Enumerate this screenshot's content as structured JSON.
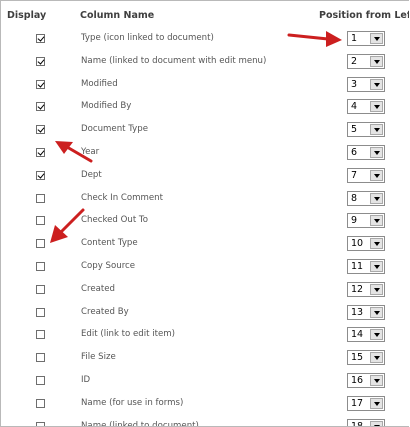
{
  "header": {
    "display": "Display",
    "column_name": "Column Name",
    "position": "Position from Lef"
  },
  "rows": [
    {
      "label": "Type (icon linked to document)",
      "checked": true,
      "position": "1"
    },
    {
      "label": "Name (linked to document with edit menu)",
      "checked": true,
      "position": "2"
    },
    {
      "label": "Modified",
      "checked": true,
      "position": "3"
    },
    {
      "label": "Modified By",
      "checked": true,
      "position": "4"
    },
    {
      "label": "Document Type",
      "checked": true,
      "position": "5"
    },
    {
      "label": "Year",
      "checked": true,
      "position": "6"
    },
    {
      "label": "Dept",
      "checked": true,
      "position": "7"
    },
    {
      "label": "Check In Comment",
      "checked": false,
      "position": "8"
    },
    {
      "label": "Checked Out To",
      "checked": false,
      "position": "9"
    },
    {
      "label": "Content Type",
      "checked": false,
      "position": "10"
    },
    {
      "label": "Copy Source",
      "checked": false,
      "position": "11"
    },
    {
      "label": "Created",
      "checked": false,
      "position": "12"
    },
    {
      "label": "Created By",
      "checked": false,
      "position": "13"
    },
    {
      "label": "Edit (link to edit item)",
      "checked": false,
      "position": "14"
    },
    {
      "label": "File Size",
      "checked": false,
      "position": "15"
    },
    {
      "label": "ID",
      "checked": false,
      "position": "16"
    },
    {
      "label": "Name (for use in forms)",
      "checked": false,
      "position": "17"
    },
    {
      "label": "Name (linked to document)",
      "checked": false,
      "position": "18"
    }
  ],
  "annotation_color": "#cc1f1f"
}
